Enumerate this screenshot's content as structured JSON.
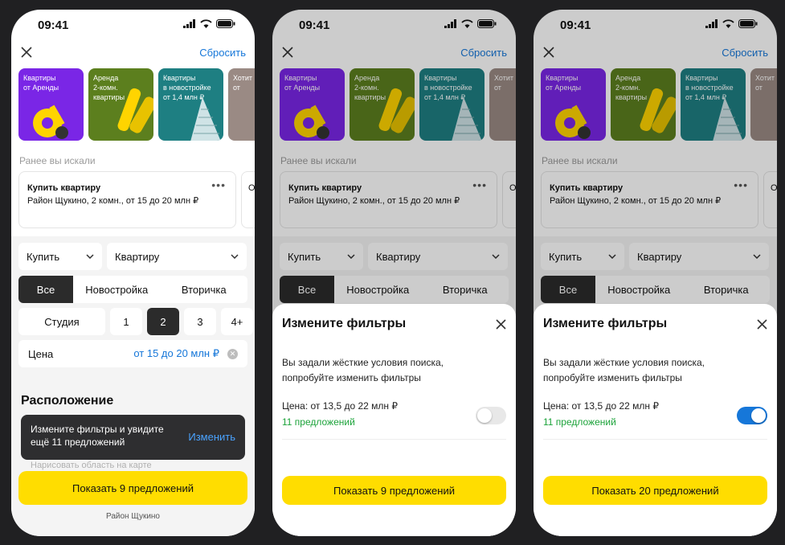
{
  "status": {
    "time": "09:41"
  },
  "header": {
    "reset_label": "Сбросить"
  },
  "banners": [
    {
      "line1": "Квартиры",
      "line2": "от Аренды",
      "color": "#7a26e6"
    },
    {
      "line1": "Аренда",
      "line2": "2-комн.",
      "line3": "квартиры",
      "color": "#5c7f1e"
    },
    {
      "line1": "Квартиры",
      "line2": "в новостройке",
      "line3": "от 1,4 млн ₽",
      "color": "#1e7f82"
    },
    {
      "line1": "Хотит",
      "line2": "от",
      "color": "#9a8a84"
    }
  ],
  "recent": {
    "label": "Ранее вы искали",
    "card_title": "Купить квартиру",
    "card_desc": "Район Щукино, 2 комн., от 15 до 20 млн ₽",
    "card2_initial": "О"
  },
  "filters": {
    "deal": "Купить",
    "property": "Квартиру",
    "market_tabs": [
      "Все",
      "Новостройка",
      "Вторичка"
    ],
    "rooms": [
      "Студия",
      "1",
      "2",
      "3",
      "4+"
    ],
    "price_label": "Цена",
    "price_value": "от 15 до 20 млн ₽"
  },
  "location": {
    "title": "Расположение",
    "draw_hint": "Нарисовать область на карте"
  },
  "toast": {
    "line1": "Измените фильтры и увидите",
    "line2": "ещё 11 предложений",
    "action": "Изменить"
  },
  "show_button_9": "Показать 9 предложений",
  "show_button_20": "Показать 20 предложений",
  "district_caption": "Район Щукино",
  "sheet": {
    "title": "Измените фильтры",
    "desc_line1": "Вы задали жёсткие условия поиска,",
    "desc_line2": "попробуйте изменить фильтры",
    "price_text": "Цена: от 13,5 до 22 млн ₽",
    "count_text": "11 предложений"
  },
  "colors": {
    "accent": "#1677d9",
    "cta": "#ffdd00",
    "success": "#1ca33a"
  }
}
